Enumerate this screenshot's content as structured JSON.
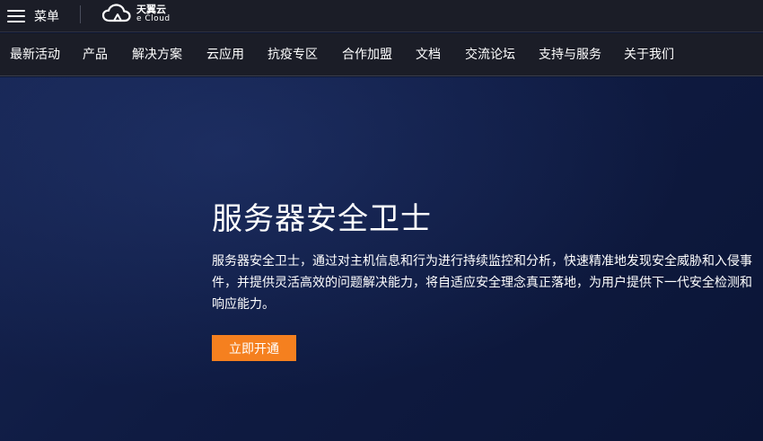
{
  "header": {
    "menu_label": "菜单",
    "logo_cn": "天翼云",
    "logo_en": "e Cloud",
    "menu_icon": "hamburger-menu-icon",
    "logo_icon": "cloud-logo-icon"
  },
  "nav": {
    "items": [
      {
        "label": "最新活动"
      },
      {
        "label": "产品"
      },
      {
        "label": "解决方案"
      },
      {
        "label": "云应用"
      },
      {
        "label": "抗疫专区"
      },
      {
        "label": "合作加盟"
      },
      {
        "label": "文档"
      },
      {
        "label": "交流论坛"
      },
      {
        "label": "支持与服务"
      },
      {
        "label": "关于我们"
      }
    ]
  },
  "hero": {
    "title": "服务器安全卫士",
    "description": "服务器安全卫士，通过对主机信息和行为进行持续监控和分析，快速精准地发现安全威胁和入侵事件，并提供灵活高效的问题解决能力，将自适应安全理念真正落地，为用户提供下一代安全检测和响应能力。",
    "cta_label": "立即开通"
  },
  "colors": {
    "topbar_bg": "#1b1d27",
    "hero_bg": "#0f1b42",
    "cta_bg": "#f5801f",
    "text": "#ffffff"
  }
}
